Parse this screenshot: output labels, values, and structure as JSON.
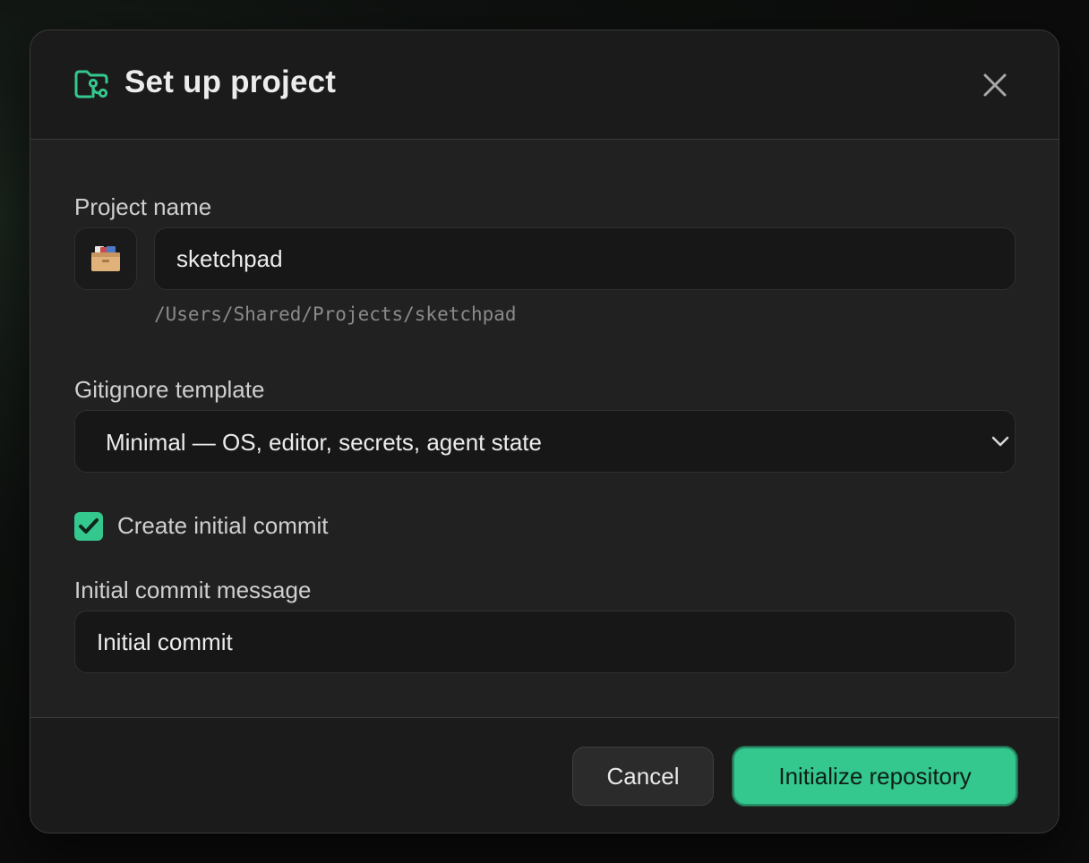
{
  "dialog": {
    "title": "Set up project",
    "header_icon": "folder-git-icon",
    "close_icon": "close-icon"
  },
  "project": {
    "label": "Project name",
    "emoji_icon": "card-file-box-icon",
    "name_value": "sketchpad",
    "path": "/Users/Shared/Projects/sketchpad"
  },
  "gitignore": {
    "label": "Gitignore template",
    "selected": "Minimal — OS, editor, secrets, agent state",
    "chevron_icon": "chevron-down-icon"
  },
  "commit": {
    "checkbox_label": "Create initial commit",
    "checked": true,
    "message_label": "Initial commit message",
    "message_value": "Initial commit"
  },
  "footer": {
    "cancel_label": "Cancel",
    "primary_label": "Initialize repository"
  },
  "colors": {
    "accent": "#34c78e",
    "background": "#212121",
    "header": "#1b1b1b"
  }
}
